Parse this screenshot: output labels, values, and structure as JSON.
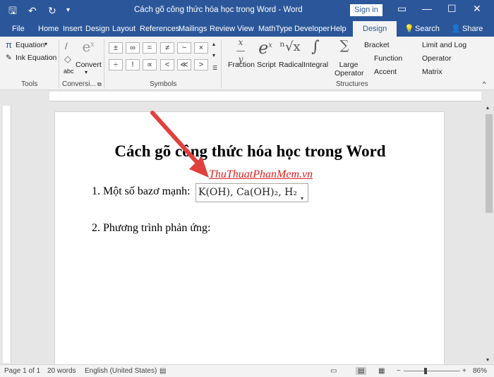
{
  "window": {
    "title": "Cách gõ công thức hóa học trong Word  -  Word",
    "signin": "Sign in",
    "qa_save": "🖫",
    "qa_undo": "↶",
    "qa_redo": "↻",
    "qa_more": "▾",
    "win_restore": "▭",
    "win_min": "—",
    "win_max": "☐",
    "win_close": "✕"
  },
  "tabs": [
    "File",
    "Home",
    "Insert",
    "Design",
    "Layout",
    "References",
    "Mailings",
    "Review",
    "View",
    "MathType",
    "Developer",
    "Help",
    "Design"
  ],
  "tell_me": "Search",
  "share": "Share",
  "ribbon": {
    "equation": "Equation",
    "ink_equation": "Ink Equation",
    "convert": "Convert",
    "abc": "abc",
    "tools_label": "Tools",
    "conversions_label": "Conversi...",
    "symbols_label": "Symbols",
    "structures_label": "Structures",
    "symbols": [
      "±",
      "∞",
      "=",
      "≠",
      "~",
      "×",
      "÷",
      "!",
      "∝",
      "<",
      "≪",
      ">"
    ],
    "fraction": "Fraction",
    "script": "Script",
    "radical": "Radical",
    "integral": "Integral",
    "large_operator": "Large Operator",
    "bracket": "Bracket",
    "function": "Function",
    "accent": "Accent",
    "limit_log": "Limit and Log",
    "operator": "Operator",
    "matrix": "Matrix"
  },
  "document": {
    "title": "Cách gõ công thức hóa học trong Word",
    "watermark": "ThuThuatPhanMem.vn",
    "line1": "1. Một số bazơ mạnh:",
    "equation": "K(OH), Ca(OH)₂, H₂",
    "line2": "2. Phương trình phản ứng:"
  },
  "status": {
    "page": "Page 1 of 1",
    "words": "20 words",
    "language": "English (United States)",
    "zoom": "86%"
  }
}
